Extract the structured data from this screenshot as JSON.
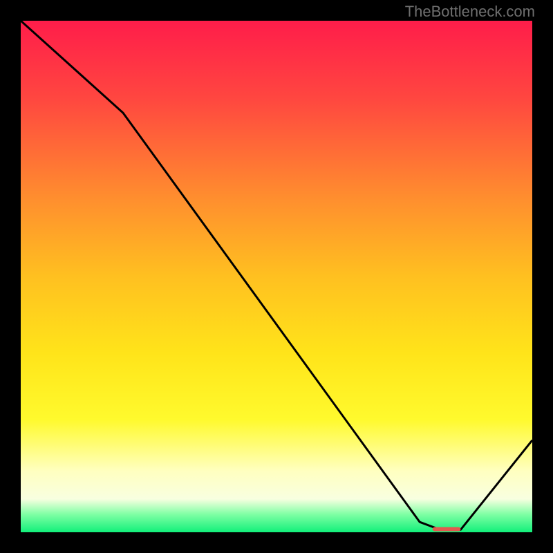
{
  "watermark": "TheBottleneck.com",
  "chart_data": {
    "type": "line",
    "title": "",
    "xlabel": "",
    "ylabel": "",
    "xlim": [
      0,
      100
    ],
    "ylim": [
      0,
      100
    ],
    "series": [
      {
        "name": "bottleneck-curve",
        "x": [
          0,
          20,
          78,
          82,
          86,
          100
        ],
        "y": [
          100,
          82,
          2,
          0.5,
          0.5,
          18
        ]
      }
    ],
    "marker": {
      "name": "target-marker",
      "x_start": 80.5,
      "x_end": 86,
      "y": 0.6,
      "color": "#e25a4f"
    },
    "background_gradient": {
      "type": "vertical",
      "stops": [
        {
          "offset": 0.0,
          "color": "#ff1d4a"
        },
        {
          "offset": 0.15,
          "color": "#ff4640"
        },
        {
          "offset": 0.35,
          "color": "#ff8f2e"
        },
        {
          "offset": 0.5,
          "color": "#ffc020"
        },
        {
          "offset": 0.65,
          "color": "#ffe41a"
        },
        {
          "offset": 0.78,
          "color": "#fffa2d"
        },
        {
          "offset": 0.88,
          "color": "#ffffc0"
        },
        {
          "offset": 0.935,
          "color": "#f8ffe0"
        },
        {
          "offset": 0.965,
          "color": "#7fffa4"
        },
        {
          "offset": 1.0,
          "color": "#12f07a"
        }
      ]
    }
  }
}
